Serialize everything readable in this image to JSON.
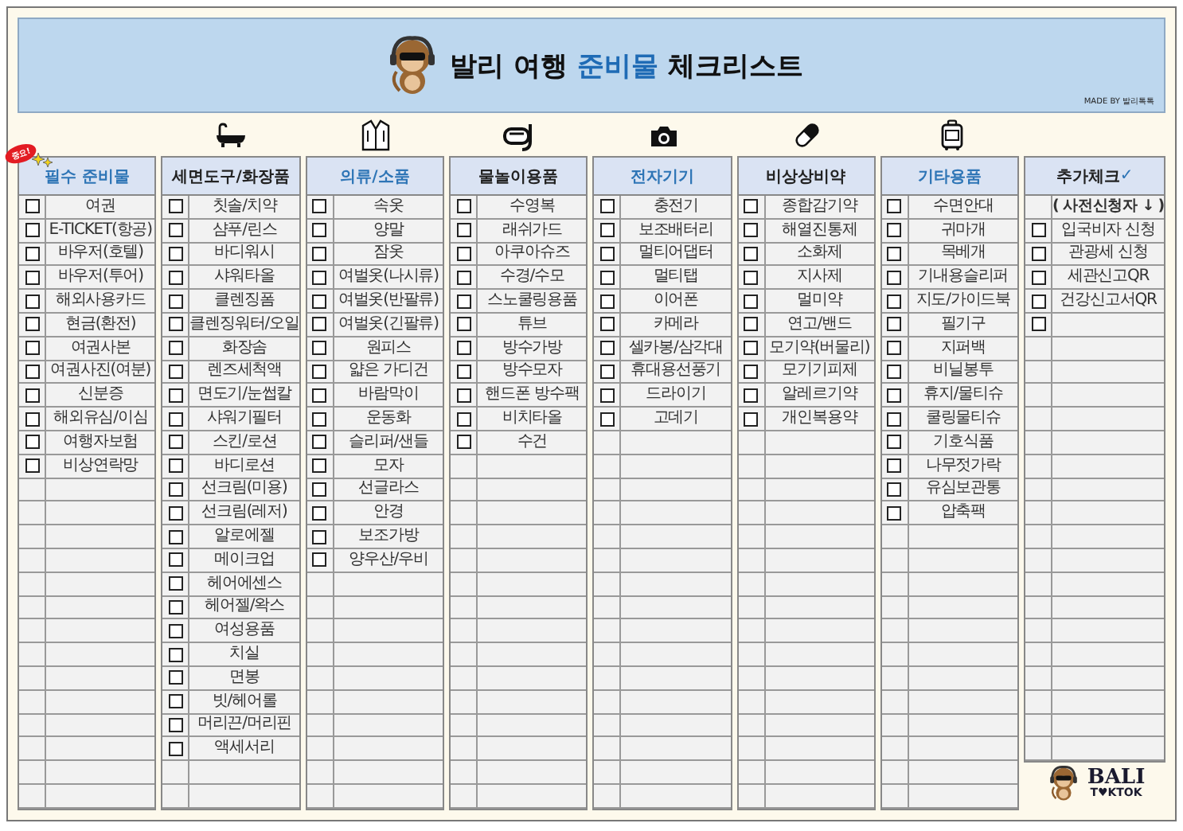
{
  "banner": {
    "title_start": "발리 여행",
    "title_highlight": "준비물",
    "title_end": "체크리스트",
    "credit": "MADE BY 발리톡톡"
  },
  "columns": [
    {
      "title": "필수 준비물",
      "accent": true,
      "badge": "중요!",
      "items": [
        {
          "kind": "check",
          "label": "여권",
          "checked": false
        },
        {
          "kind": "check",
          "label": "E-TICKET(항공)",
          "checked": false
        },
        {
          "kind": "check",
          "label": "바우저(호텔)",
          "checked": false
        },
        {
          "kind": "check",
          "label": "바우저(투어)",
          "checked": false
        },
        {
          "kind": "check",
          "label": "해외사용카드",
          "checked": false
        },
        {
          "kind": "check",
          "label": "현금(환전)",
          "checked": false
        },
        {
          "kind": "check",
          "label": "여권사본",
          "checked": false
        },
        {
          "kind": "check",
          "label": "여권사진(여분)",
          "checked": false
        },
        {
          "kind": "check",
          "label": "신분증",
          "checked": false
        },
        {
          "kind": "check",
          "label": "해외유심/이심",
          "checked": false
        },
        {
          "kind": "check",
          "label": "여행자보험",
          "checked": false
        },
        {
          "kind": "check",
          "label": "비상연락망",
          "checked": false
        }
      ]
    },
    {
      "title": "세면도구/화장품",
      "accent": false,
      "items": [
        {
          "kind": "check",
          "label": "칫솔/치약",
          "checked": false
        },
        {
          "kind": "check",
          "label": "샴푸/린스",
          "checked": false
        },
        {
          "kind": "check",
          "label": "바디워시",
          "checked": false
        },
        {
          "kind": "check",
          "label": "샤워타올",
          "checked": false
        },
        {
          "kind": "check",
          "label": "클렌징폼",
          "checked": false
        },
        {
          "kind": "check",
          "label": "클렌징워터/오일",
          "checked": false
        },
        {
          "kind": "check",
          "label": "화장솜",
          "checked": false
        },
        {
          "kind": "check",
          "label": "렌즈세척액",
          "checked": false
        },
        {
          "kind": "check",
          "label": "면도기/눈썹칼",
          "checked": false
        },
        {
          "kind": "check",
          "label": "샤워기필터",
          "checked": false
        },
        {
          "kind": "check",
          "label": "스킨/로션",
          "checked": false
        },
        {
          "kind": "check",
          "label": "바디로션",
          "checked": false
        },
        {
          "kind": "check",
          "label": "선크림(미용)",
          "checked": false
        },
        {
          "kind": "check",
          "label": "선크림(레저)",
          "checked": false
        },
        {
          "kind": "check",
          "label": "알로에젤",
          "checked": false
        },
        {
          "kind": "check",
          "label": "메이크업",
          "checked": false
        },
        {
          "kind": "check",
          "label": "헤어에센스",
          "checked": false
        },
        {
          "kind": "check",
          "label": "헤어젤/왁스",
          "checked": false
        },
        {
          "kind": "check",
          "label": "여성용품",
          "checked": false
        },
        {
          "kind": "check",
          "label": "치실",
          "checked": false
        },
        {
          "kind": "check",
          "label": "면봉",
          "checked": false
        },
        {
          "kind": "check",
          "label": "빗/헤어롤",
          "checked": false
        },
        {
          "kind": "check",
          "label": "머리끈/머리핀",
          "checked": false
        },
        {
          "kind": "check",
          "label": "액세서리",
          "checked": false
        }
      ]
    },
    {
      "title": "의류/소품",
      "accent": true,
      "items": [
        {
          "kind": "check",
          "label": "속옷",
          "checked": false
        },
        {
          "kind": "check",
          "label": "양말",
          "checked": false
        },
        {
          "kind": "check",
          "label": "잠옷",
          "checked": false
        },
        {
          "kind": "check",
          "label": "여벌옷(나시류)",
          "checked": false
        },
        {
          "kind": "check",
          "label": "여벌옷(반팔류)",
          "checked": false
        },
        {
          "kind": "check",
          "label": "여벌옷(긴팔류)",
          "checked": false
        },
        {
          "kind": "check",
          "label": "원피스",
          "checked": false
        },
        {
          "kind": "check",
          "label": "얇은 가디건",
          "checked": false
        },
        {
          "kind": "check",
          "label": "바람막이",
          "checked": false
        },
        {
          "kind": "check",
          "label": "운동화",
          "checked": false
        },
        {
          "kind": "check",
          "label": "슬리퍼/샌들",
          "checked": false
        },
        {
          "kind": "check",
          "label": "모자",
          "checked": false
        },
        {
          "kind": "check",
          "label": "선글라스",
          "checked": false
        },
        {
          "kind": "check",
          "label": "안경",
          "checked": false
        },
        {
          "kind": "check",
          "label": "보조가방",
          "checked": false
        },
        {
          "kind": "check",
          "label": "양우산/우비",
          "checked": false
        }
      ]
    },
    {
      "title": "물놀이용품",
      "accent": false,
      "items": [
        {
          "kind": "check",
          "label": "수영복",
          "checked": false
        },
        {
          "kind": "check",
          "label": "래쉬가드",
          "checked": false
        },
        {
          "kind": "check",
          "label": "아쿠아슈즈",
          "checked": false
        },
        {
          "kind": "check",
          "label": "수경/수모",
          "checked": false
        },
        {
          "kind": "check",
          "label": "스노쿨링용품",
          "checked": false
        },
        {
          "kind": "check",
          "label": "튜브",
          "checked": false
        },
        {
          "kind": "check",
          "label": "방수가방",
          "checked": false
        },
        {
          "kind": "check",
          "label": "방수모자",
          "checked": false
        },
        {
          "kind": "check",
          "label": "핸드폰 방수팩",
          "checked": false
        },
        {
          "kind": "check",
          "label": "비치타올",
          "checked": false
        },
        {
          "kind": "check",
          "label": "수건",
          "checked": false
        }
      ]
    },
    {
      "title": "전자기기",
      "accent": true,
      "items": [
        {
          "kind": "check",
          "label": "충전기",
          "checked": false
        },
        {
          "kind": "check",
          "label": "보조배터리",
          "checked": false
        },
        {
          "kind": "check",
          "label": "멀티어댑터",
          "checked": false
        },
        {
          "kind": "check",
          "label": "멀티탭",
          "checked": false
        },
        {
          "kind": "check",
          "label": "이어폰",
          "checked": false
        },
        {
          "kind": "check",
          "label": "카메라",
          "checked": false
        },
        {
          "kind": "check",
          "label": "셀카봉/삼각대",
          "checked": false
        },
        {
          "kind": "check",
          "label": "휴대용선풍기",
          "checked": false
        },
        {
          "kind": "check",
          "label": "드라이기",
          "checked": false
        },
        {
          "kind": "check",
          "label": "고데기",
          "checked": false
        }
      ]
    },
    {
      "title": "비상상비약",
      "accent": false,
      "items": [
        {
          "kind": "check",
          "label": "종합감기약",
          "checked": false
        },
        {
          "kind": "check",
          "label": "해열진통제",
          "checked": false
        },
        {
          "kind": "check",
          "label": "소화제",
          "checked": false
        },
        {
          "kind": "check",
          "label": "지사제",
          "checked": false
        },
        {
          "kind": "check",
          "label": "멀미약",
          "checked": false
        },
        {
          "kind": "check",
          "label": "연고/밴드",
          "checked": false
        },
        {
          "kind": "check",
          "label": "모기약(버물리)",
          "checked": false
        },
        {
          "kind": "check",
          "label": "모기기피제",
          "checked": false
        },
        {
          "kind": "check",
          "label": "알레르기약",
          "checked": false
        },
        {
          "kind": "check",
          "label": "개인복용약",
          "checked": false
        }
      ]
    },
    {
      "title": "기타용품",
      "accent": true,
      "items": [
        {
          "kind": "check",
          "label": "수면안대",
          "checked": false
        },
        {
          "kind": "check",
          "label": "귀마개",
          "checked": false
        },
        {
          "kind": "check",
          "label": "목베개",
          "checked": false
        },
        {
          "kind": "check",
          "label": "기내용슬리퍼",
          "checked": false
        },
        {
          "kind": "check",
          "label": "지도/가이드북",
          "checked": false
        },
        {
          "kind": "check",
          "label": "필기구",
          "checked": false
        },
        {
          "kind": "check",
          "label": "지퍼백",
          "checked": false
        },
        {
          "kind": "check",
          "label": "비닐봉투",
          "checked": false
        },
        {
          "kind": "check",
          "label": "휴지/물티슈",
          "checked": false
        },
        {
          "kind": "check",
          "label": "쿨링물티슈",
          "checked": false
        },
        {
          "kind": "check",
          "label": "기호식품",
          "checked": false
        },
        {
          "kind": "check",
          "label": "나무젓가락",
          "checked": false
        },
        {
          "kind": "check",
          "label": "유심보관통",
          "checked": false
        },
        {
          "kind": "check",
          "label": "압축팩",
          "checked": false
        }
      ]
    },
    {
      "title": "추가체크",
      "accent": false,
      "title_mark": "✓",
      "items": [
        {
          "kind": "note",
          "label": "( 사전신청자 ↓ )"
        },
        {
          "kind": "check",
          "label": "입국비자 신청",
          "checked": false
        },
        {
          "kind": "check",
          "label": "관광세 신청",
          "checked": false
        },
        {
          "kind": "check",
          "label": "세관신고QR",
          "checked": false
        },
        {
          "kind": "check",
          "label": "건강신고서QR",
          "checked": false
        },
        {
          "kind": "check",
          "checked": false
        }
      ]
    }
  ],
  "logo": {
    "line_1": "BALI",
    "line_2": "T♥KTOK"
  }
}
